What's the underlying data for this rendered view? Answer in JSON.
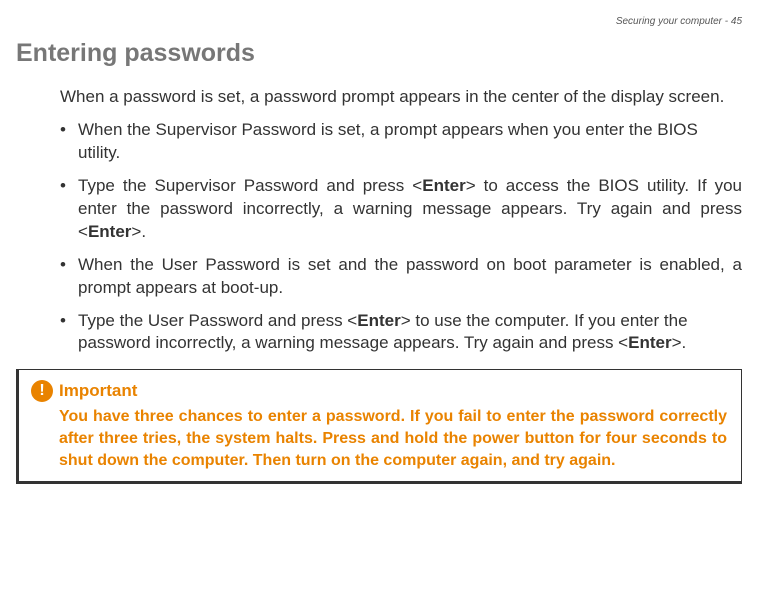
{
  "header": {
    "breadcrumb": "Securing your computer - 45"
  },
  "title": "Entering passwords",
  "intro": "When a password is set, a password prompt appears in the center of the display screen.",
  "bullets": [
    {
      "plain": "When the Supervisor Password is set, a prompt appears when you enter the BIOS utility.",
      "justify": false
    },
    {
      "pre1": "Type the Supervisor Password and press <",
      "bold1": "Enter",
      "mid1": "> to access the BIOS utility. If you enter the password incorrectly, a warning message appears. Try again and press <",
      "bold2": "Enter",
      "post1": ">.",
      "justify": true
    },
    {
      "plain": "When the User Password is set and the password on boot parameter is enabled, a prompt appears at boot-up.",
      "justify": true
    },
    {
      "pre1": "Type the User Password and press <",
      "bold1": "Enter",
      "mid1": "> to use the computer. If you enter the password incorrectly, a warning message appears. Try again and press <",
      "bold2": "Enter",
      "post1": ">.",
      "justify": false
    }
  ],
  "important": {
    "icon_glyph": "!",
    "label": "Important",
    "body": "You have three chances to enter a password. If you fail to enter the password correctly after three tries, the system halts. Press and hold the power button for four seconds to shut down the computer. Then turn on the computer again, and try again."
  }
}
